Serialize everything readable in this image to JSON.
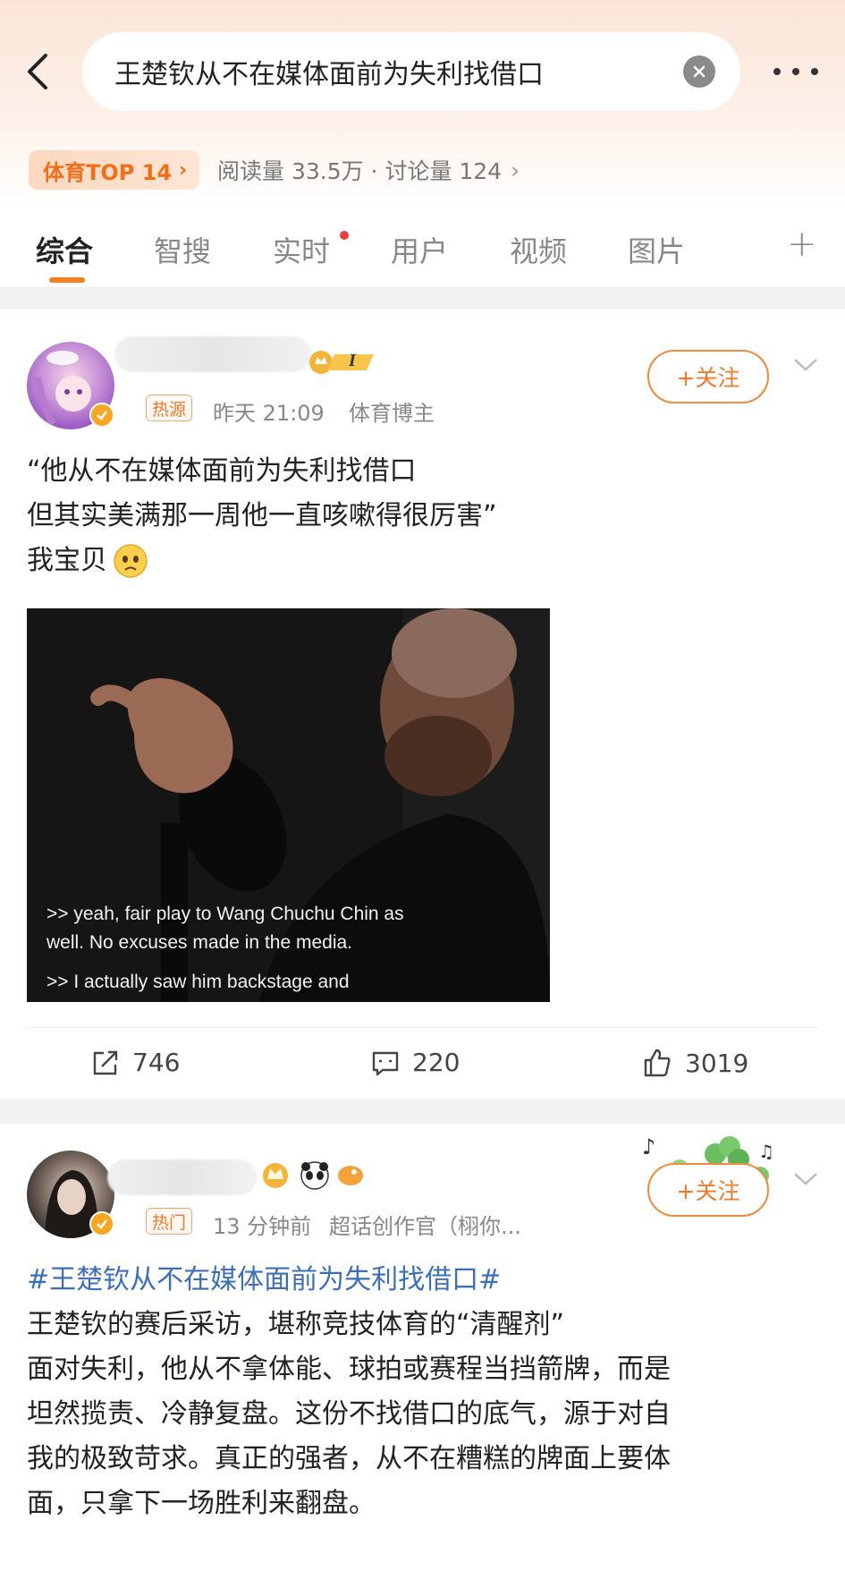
{
  "search": {
    "query": "王楚钦从不在媒体面前为失利找借口"
  },
  "topic": {
    "rank_label": "体育TOP 14",
    "stats": "阅读量 33.5万 · 讨论量 124"
  },
  "tabs": [
    {
      "label": "综合",
      "active": true
    },
    {
      "label": "智搜"
    },
    {
      "label": "实时",
      "has_dot": true
    },
    {
      "label": "用户"
    },
    {
      "label": "视频"
    },
    {
      "label": "图片"
    }
  ],
  "post1": {
    "badge": "热源",
    "time": "昨天 21:09",
    "role": "体育博主",
    "follow_label": "+关注",
    "level_badge": "I",
    "text_lines": [
      "“他从不在媒体面前为失利找借口",
      "但其实美满那一周他一直咳嗽得很厉害”",
      "我宝贝"
    ],
    "video_subtitles": [
      ">> yeah, fair play to Wang Chuchu Chin as",
      "well. No excuses made in the media.",
      ">> I actually saw him backstage and"
    ],
    "reposts": "746",
    "comments": "220",
    "likes": "3019"
  },
  "post2": {
    "badge": "热门",
    "time": "13 分钟前",
    "role": "超话创作官（栩你...",
    "follow_label": "+关注",
    "hashtag": "#王楚钦从不在媒体面前为失利找借口#",
    "text_lines": [
      "王楚钦的赛后采访，堪称竞技体育的“清醒剂”",
      "面对失利，他从不拿体能、球拍或赛程当挡箭牌，而是",
      "坦然揽责、冷静复盘。这份不找借口的底气，源于对自",
      "我的极致苛求。真正的强者，从不在糟糕的牌面上要体",
      "面，只拿下一场胜利来翻盘。"
    ]
  },
  "icons": {
    "back": "back-arrow-icon",
    "clear": "clear-icon",
    "more": "more-icon",
    "repost": "repost-icon",
    "comment": "comment-icon",
    "like": "like-icon"
  },
  "colors": {
    "accent": "#f07a2a",
    "hashtag": "#3c6fb8"
  }
}
